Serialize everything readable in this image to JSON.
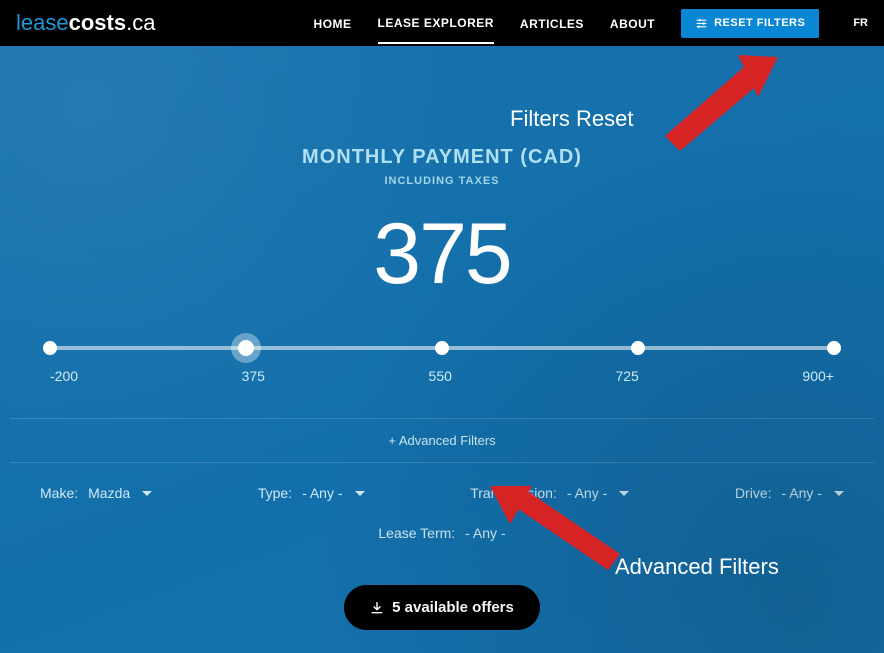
{
  "logo": {
    "part1": "lease",
    "part2": "costs",
    "tld": ".ca"
  },
  "nav": {
    "home": "HOME",
    "explorer": "LEASE EXPLORER",
    "articles": "ARTICLES",
    "about": "ABOUT",
    "reset": "RESET FILTERS",
    "lang": "FR"
  },
  "payment": {
    "title": "MONTHLY PAYMENT (CAD)",
    "subtitle": "INCLUDING TAXES",
    "value": "375"
  },
  "slider": {
    "ticks": [
      "-200",
      "375",
      "550",
      "725",
      "900+"
    ],
    "handle_percent": 25
  },
  "advanced_link": "+ Advanced Filters",
  "filters": {
    "make": {
      "label": "Make:",
      "value": "Mazda"
    },
    "type": {
      "label": "Type:",
      "value": "- Any -"
    },
    "transmission": {
      "label": "Transmission:",
      "value": "- Any -"
    },
    "drive": {
      "label": "Drive:",
      "value": "- Any -"
    },
    "lease_term": {
      "label": "Lease Term:",
      "value": "- Any -"
    }
  },
  "offers_button": "5 available offers",
  "annotations": {
    "reset": "Filters Reset",
    "advanced": "Advanced Filters"
  }
}
